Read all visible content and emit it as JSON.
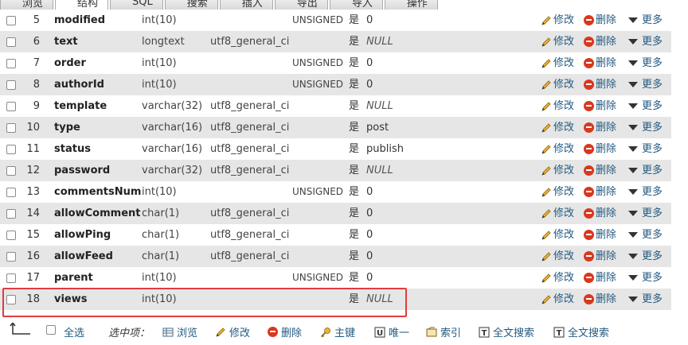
{
  "tabs": [
    {
      "label": "浏览"
    },
    {
      "label": "结构",
      "active": true
    },
    {
      "label": "SQL"
    },
    {
      "label": "搜索"
    },
    {
      "label": "插入"
    },
    {
      "label": "导出"
    },
    {
      "label": "导入"
    },
    {
      "label": "操作"
    }
  ],
  "actions": {
    "edit": "修改",
    "delete": "删除",
    "more": "更多"
  },
  "rows": [
    {
      "num": "5",
      "name": "modified",
      "type": "int(10)",
      "collation": "",
      "attributes": "UNSIGNED",
      "null": "是",
      "default": "0",
      "default_is_null": false
    },
    {
      "num": "6",
      "name": "text",
      "type": "longtext",
      "collation": "utf8_general_ci",
      "attributes": "",
      "null": "是",
      "default": "NULL",
      "default_is_null": true
    },
    {
      "num": "7",
      "name": "order",
      "type": "int(10)",
      "collation": "",
      "attributes": "UNSIGNED",
      "null": "是",
      "default": "0",
      "default_is_null": false
    },
    {
      "num": "8",
      "name": "authorId",
      "type": "int(10)",
      "collation": "",
      "attributes": "UNSIGNED",
      "null": "是",
      "default": "0",
      "default_is_null": false
    },
    {
      "num": "9",
      "name": "template",
      "type": "varchar(32)",
      "collation": "utf8_general_ci",
      "attributes": "",
      "null": "是",
      "default": "NULL",
      "default_is_null": true
    },
    {
      "num": "10",
      "name": "type",
      "type": "varchar(16)",
      "collation": "utf8_general_ci",
      "attributes": "",
      "null": "是",
      "default": "post",
      "default_is_null": false
    },
    {
      "num": "11",
      "name": "status",
      "type": "varchar(16)",
      "collation": "utf8_general_ci",
      "attributes": "",
      "null": "是",
      "default": "publish",
      "default_is_null": false
    },
    {
      "num": "12",
      "name": "password",
      "type": "varchar(32)",
      "collation": "utf8_general_ci",
      "attributes": "",
      "null": "是",
      "default": "NULL",
      "default_is_null": true
    },
    {
      "num": "13",
      "name": "commentsNum",
      "type": "int(10)",
      "collation": "",
      "attributes": "UNSIGNED",
      "null": "是",
      "default": "0",
      "default_is_null": false
    },
    {
      "num": "14",
      "name": "allowComment",
      "type": "char(1)",
      "collation": "utf8_general_ci",
      "attributes": "",
      "null": "是",
      "default": "0",
      "default_is_null": false
    },
    {
      "num": "15",
      "name": "allowPing",
      "type": "char(1)",
      "collation": "utf8_general_ci",
      "attributes": "",
      "null": "是",
      "default": "0",
      "default_is_null": false
    },
    {
      "num": "16",
      "name": "allowFeed",
      "type": "char(1)",
      "collation": "utf8_general_ci",
      "attributes": "",
      "null": "是",
      "default": "0",
      "default_is_null": false
    },
    {
      "num": "17",
      "name": "parent",
      "type": "int(10)",
      "collation": "",
      "attributes": "UNSIGNED",
      "null": "是",
      "default": "0",
      "default_is_null": false
    },
    {
      "num": "18",
      "name": "views",
      "type": "int(10)",
      "collation": "",
      "attributes": "",
      "null": "是",
      "default": "NULL",
      "default_is_null": true
    }
  ],
  "bottom": {
    "select_all": "全选",
    "with_selected": "选中项：",
    "browse": "浏览",
    "edit": "修改",
    "delete": "删除",
    "primary": "主键",
    "unique": "唯一",
    "index": "索引",
    "fulltext1": "全文搜索",
    "fulltext2": "全文搜索"
  },
  "colors": {
    "link": "#235a81",
    "row_alt": "#e6e6e6",
    "highlight": "#e03c3c",
    "delete_red": "#d9381e"
  }
}
